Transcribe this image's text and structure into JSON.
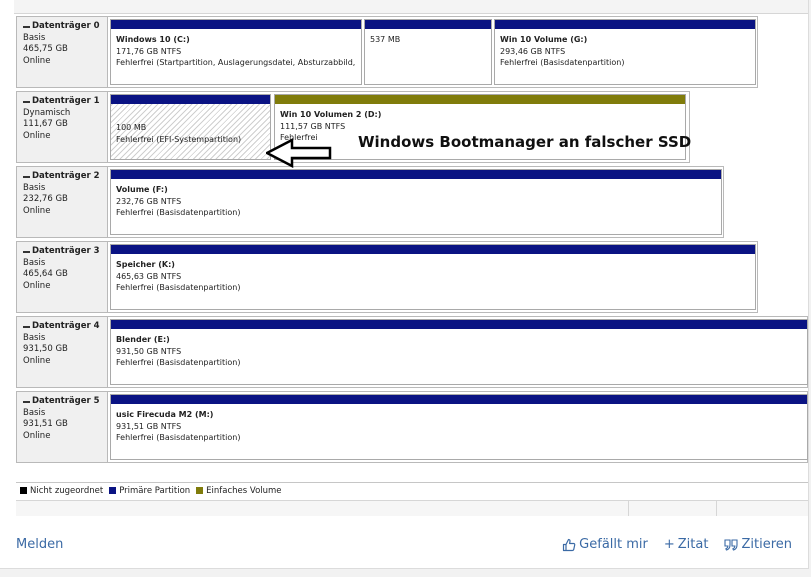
{
  "disks": [
    {
      "name": "Datenträger 0",
      "type": "Basis",
      "size": "465,75 GB",
      "status": "Online",
      "partitions": [
        {
          "title": "Windows 10  (C:)",
          "size": "171,76 GB NTFS",
          "status": "Fehlerfrei (Startpartition, Auslagerungsdatei, Absturzabbild, I"
        },
        {
          "title": "",
          "size": "537 MB",
          "status": ""
        },
        {
          "title": "Win 10 Volume  (G:)",
          "size": "293,46 GB NTFS",
          "status": "Fehlerfrei (Basisdatenpartition)"
        }
      ]
    },
    {
      "name": "Datenträger 1",
      "type": "Dynamisch",
      "size": "111,67 GB",
      "status": "Online",
      "partitions": [
        {
          "title": "",
          "size": "100 MB",
          "status": "Fehlerfrei (EFI-Systempartition)"
        },
        {
          "title": "Win 10 Volumen 2  (D:)",
          "size": "111,57 GB NTFS",
          "status": "Fehlerfrei"
        }
      ]
    },
    {
      "name": "Datenträger 2",
      "type": "Basis",
      "size": "232,76 GB",
      "status": "Online",
      "partitions": [
        {
          "title": "Volume  (F:)",
          "size": "232,76 GB NTFS",
          "status": "Fehlerfrei (Basisdatenpartition)"
        }
      ]
    },
    {
      "name": "Datenträger 3",
      "type": "Basis",
      "size": "465,64 GB",
      "status": "Online",
      "partitions": [
        {
          "title": "Speicher  (K:)",
          "size": "465,63 GB NTFS",
          "status": "Fehlerfrei (Basisdatenpartition)"
        }
      ]
    },
    {
      "name": "Datenträger 4",
      "type": "Basis",
      "size": "931,50 GB",
      "status": "Online",
      "partitions": [
        {
          "title": "Blender  (E:)",
          "size": "931,50 GB NTFS",
          "status": "Fehlerfrei (Basisdatenpartition)"
        }
      ]
    },
    {
      "name": "Datenträger 5",
      "type": "Basis",
      "size": "931,51 GB",
      "status": "Online",
      "partitions": [
        {
          "title": "usic Firecuda M2  (M:)",
          "size": "931,51 GB NTFS",
          "status": "Fehlerfrei (Basisdatenpartition)"
        }
      ]
    }
  ],
  "annotation": {
    "text": "Windows Bootmanager an falscher SSD"
  },
  "legend": [
    {
      "label": "Nicht zugeordnet",
      "color": "#000000"
    },
    {
      "label": "Primäre Partition",
      "color": "#0a1383"
    },
    {
      "label": "Einfaches Volume",
      "color": "#807c0b"
    }
  ],
  "footer": {
    "report": "Melden",
    "like": "Gefällt mir",
    "quote_plus": "Zitat",
    "quote": "Zitieren"
  },
  "colors": {
    "primary_bar": "#0a1383",
    "simple_volume_bar": "#807c0b",
    "link": "#3b6aa5"
  }
}
